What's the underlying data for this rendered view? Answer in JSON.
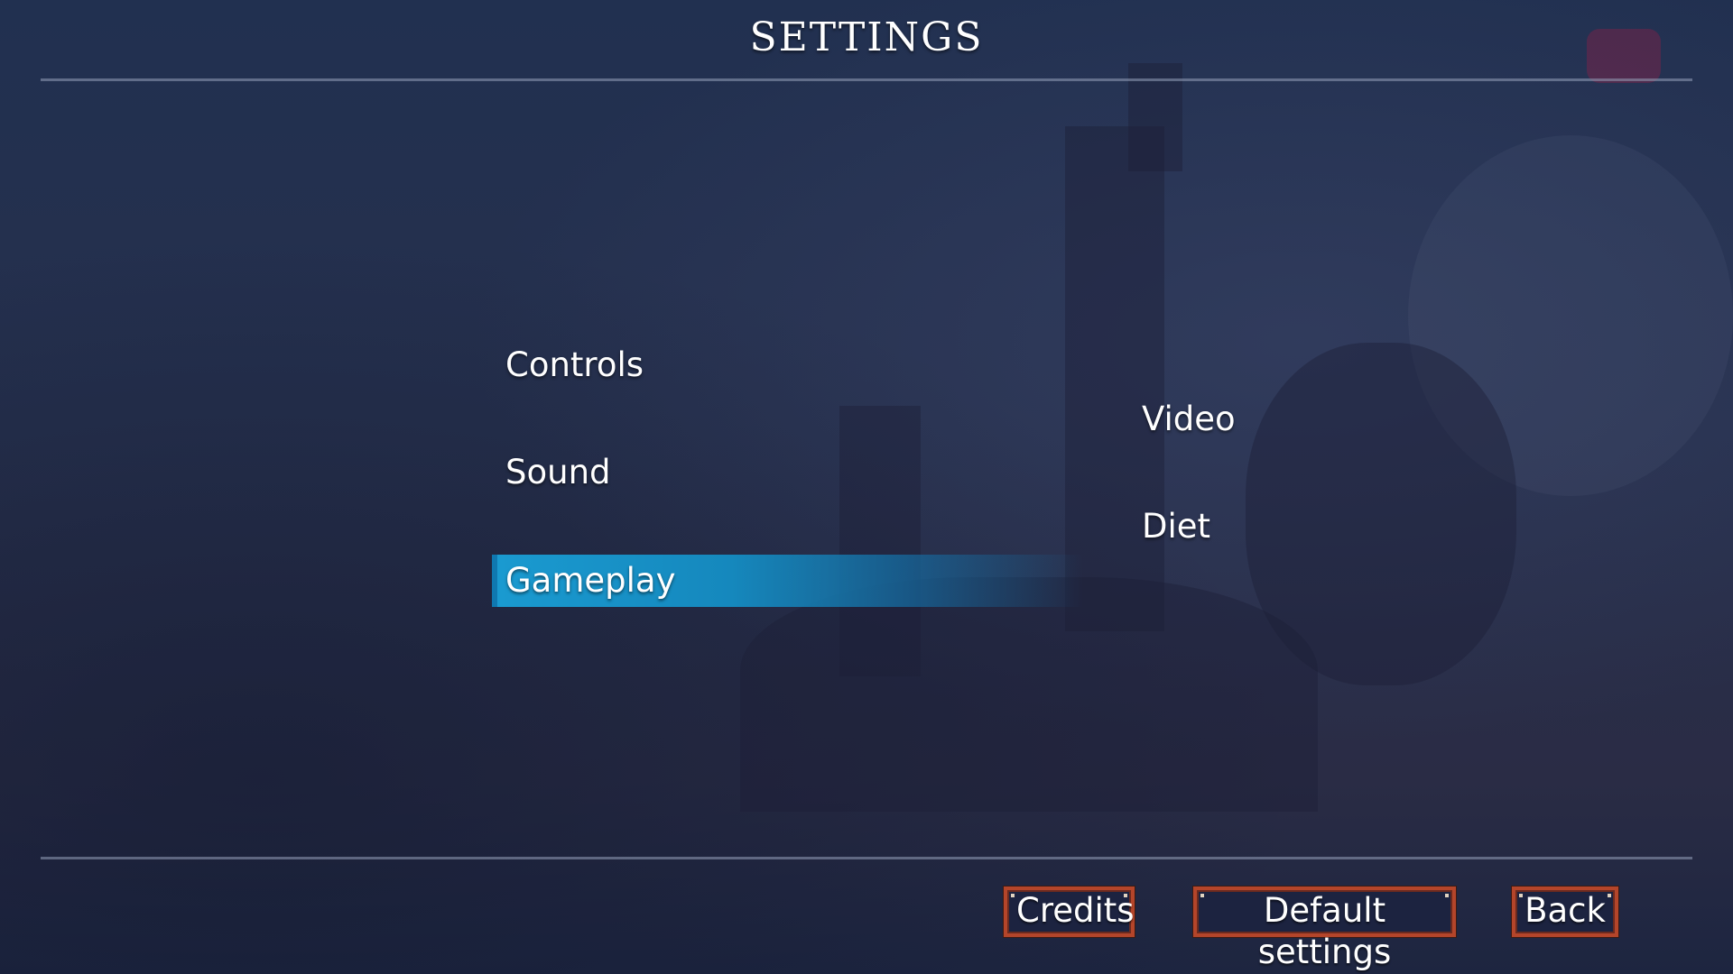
{
  "header": {
    "title": "SETTINGS"
  },
  "menu": {
    "items": [
      {
        "label": "Controls",
        "selected": false
      },
      {
        "label": "Sound",
        "selected": false
      },
      {
        "label": "Gameplay",
        "selected": true
      },
      {
        "label": "Video",
        "selected": false
      },
      {
        "label": "Diet",
        "selected": false
      }
    ]
  },
  "footer": {
    "credits_label": "Credits",
    "default_label": "Default settings",
    "back_label": "Back"
  },
  "colors": {
    "selection": "#1a9ad0",
    "button_border": "#b4452a",
    "button_bg": "#1c2340",
    "background": "#232d4b"
  },
  "icons": {
    "top_right": "controller-icon"
  }
}
